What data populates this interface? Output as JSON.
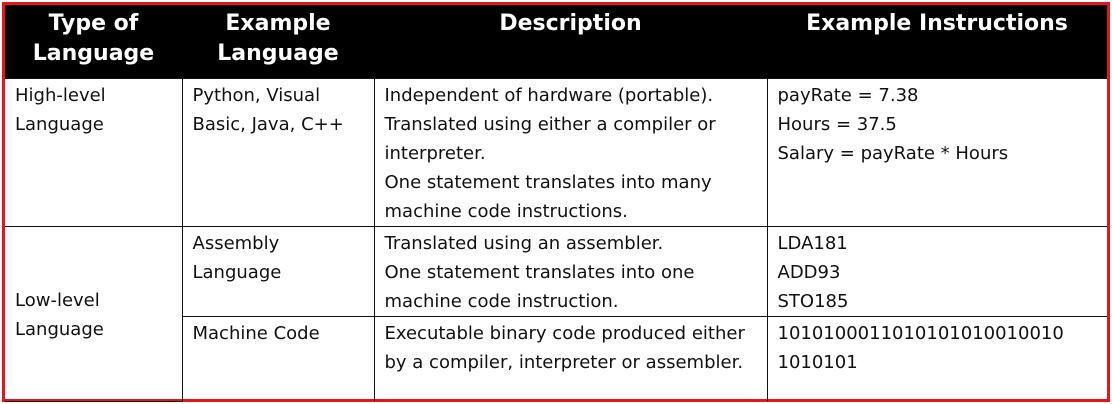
{
  "headers": {
    "type_of_language": "Type of Language",
    "example_language": "Example Language",
    "description": "Description",
    "example_instructions": "Example Instructions"
  },
  "rows": {
    "high_level": {
      "type": "High-level Language",
      "example_language": "Python, Visual Basic, Java, C++",
      "description_lines": [
        "Independent of hardware (portable).",
        "Translated using either a compiler or interpreter.",
        "One statement translates into many machine code instructions."
      ],
      "instructions": [
        "payRate = 7.38",
        "Hours = 37.5",
        "Salary = payRate * Hours"
      ]
    },
    "low_level": {
      "type": "Low-level Language"
    },
    "assembly": {
      "example_language": "Assembly Language",
      "description_lines": [
        "Translated using an assembler.",
        "One statement translates into one machine code instruction."
      ],
      "instructions": [
        "LDA181",
        "ADD93",
        "STO185"
      ]
    },
    "machine_code": {
      "example_language": "Machine Code",
      "description_lines": [
        "Executable binary code produced either by a compiler, interpreter or assembler."
      ],
      "instructions": [
        "1010100011010101010010010",
        "1010101"
      ]
    }
  },
  "colors": {
    "border_accent": "#e8141b",
    "header_bg": "#000000",
    "header_text": "#ffffff"
  }
}
